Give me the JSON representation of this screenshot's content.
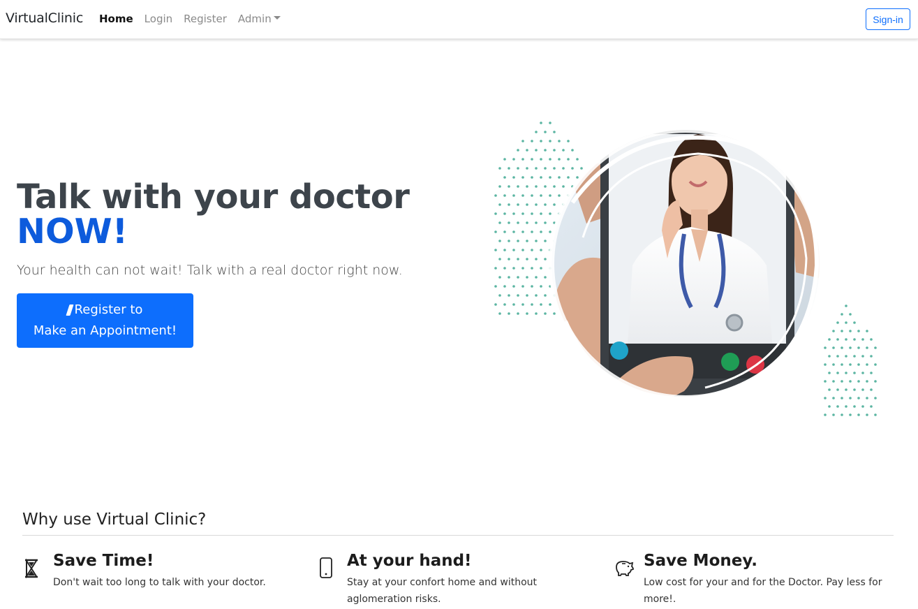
{
  "navbar": {
    "brand": "VirtualClinic",
    "links": [
      {
        "label": "Home",
        "active": true
      },
      {
        "label": "Login",
        "active": false
      },
      {
        "label": "Register",
        "active": false
      },
      {
        "label": "Admin",
        "active": false
      }
    ],
    "signin_label": "Sign-in"
  },
  "hero": {
    "title": "Talk with your doctor",
    "title_emphasis": "NOW!",
    "subtitle": "Your health can not wait! Talk with a real doctor right now.",
    "cta_line1": "Register to",
    "cta_line2": "Make an Appointment!",
    "cta_icon": "pen-icon"
  },
  "why": {
    "heading": "Why use Virtual Clinic?",
    "features": [
      {
        "icon": "hourglass-icon",
        "title": "Save Time!",
        "description": "Don't wait too long to talk with your doctor."
      },
      {
        "icon": "phone-icon",
        "title": "At your hand!",
        "description": "Stay at your confort home and without aglomeration risks."
      },
      {
        "icon": "piggy-bank-icon",
        "title": "Save Money.",
        "description": "Low cost for your and for the Doctor. Pay less for more!."
      }
    ]
  },
  "colors": {
    "primary": "#0d6efd",
    "emphasis": "#0d5bdc",
    "heading": "#3d444b",
    "dots": "#5bb5a2"
  }
}
